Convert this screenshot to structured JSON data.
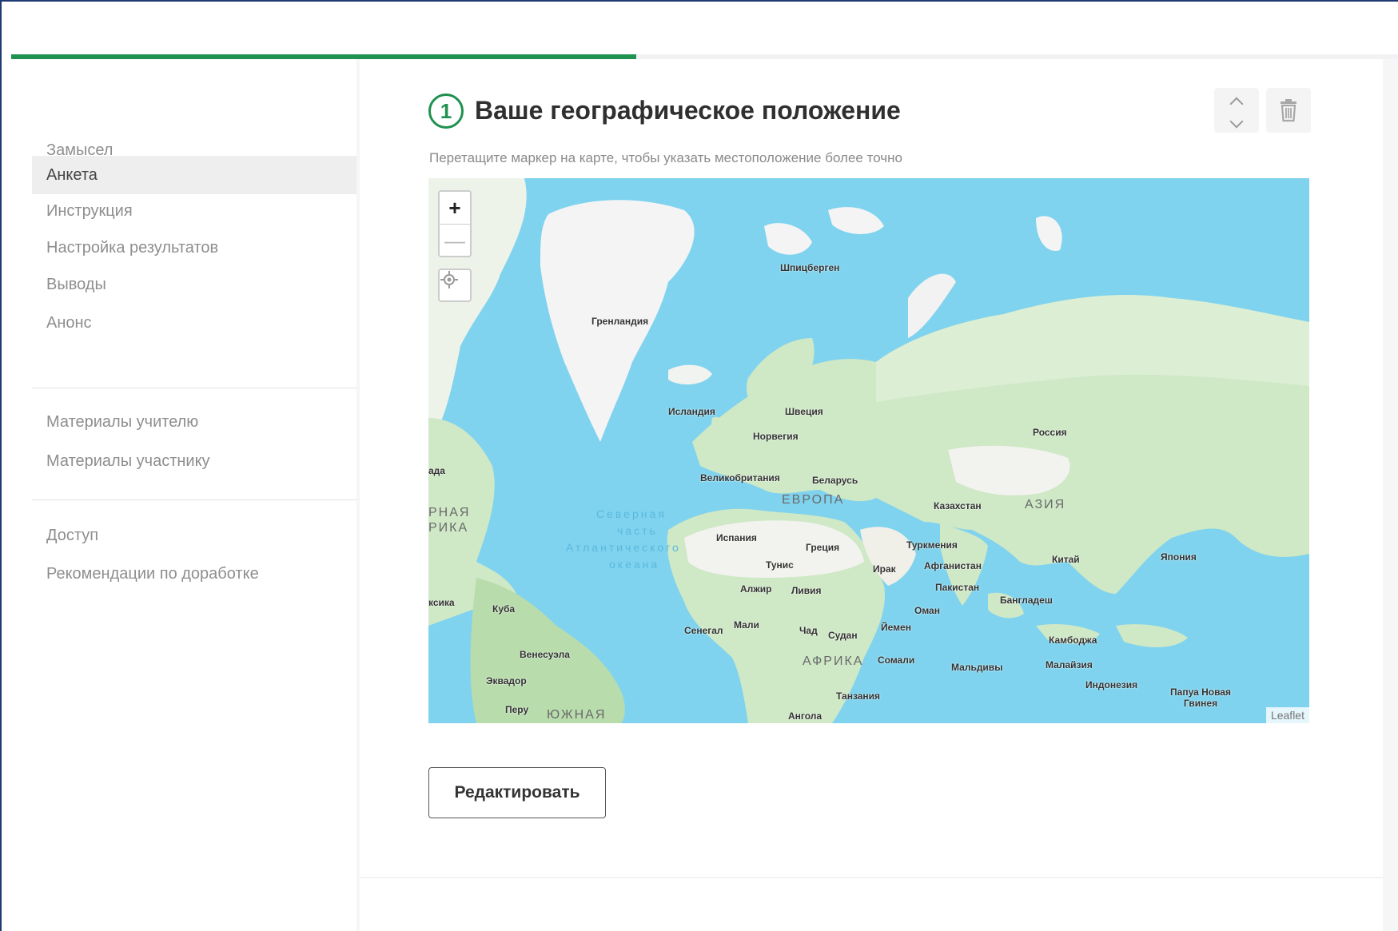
{
  "progress": {
    "fraction": 0.45
  },
  "sidebar": {
    "items": [
      {
        "label": "Замысел",
        "active": false
      },
      {
        "label": "Анкета",
        "active": true
      },
      {
        "label": "Инструкция",
        "active": false
      },
      {
        "label": "Настройка результатов",
        "active": false
      },
      {
        "label": "Выводы",
        "active": false
      },
      {
        "label": "Анонс",
        "active": false
      }
    ],
    "materials": [
      {
        "label": "Материалы учителю"
      },
      {
        "label": "Материалы участнику"
      }
    ],
    "other": [
      {
        "label": "Доступ"
      },
      {
        "label": "Рекомендации по доработке"
      }
    ]
  },
  "question": {
    "number": "1",
    "title": "Ваше географическое положение",
    "hint": "Перетащите маркер на карте, чтобы указать местоположение более точно",
    "controls": {
      "move": "chevron-updown-icon",
      "delete": "trash-icon"
    }
  },
  "map": {
    "zoom_in": "+",
    "zoom_out": "—",
    "attribution": "Leaflet",
    "colors": {
      "ocean": "#7fd3ee",
      "land": "#cfe8c6",
      "ice": "#f4f4f4"
    },
    "labels": {
      "svalbard": "Шпицберген",
      "greenland": "Гренландия",
      "iceland": "Исландия",
      "sweden": "Швеция",
      "norway": "Норвегия",
      "russia": "Россия",
      "uk": "Великобритания",
      "belarus": "Беларусь",
      "kazakhstan": "Казахстан",
      "turkmenistan": "Туркмения",
      "spain": "Испания",
      "greece": "Греция",
      "afghanistan": "Афганистан",
      "china": "Китай",
      "japan": "Япония",
      "tunisia": "Тунис",
      "iraq": "Ирак",
      "pakistan": "Пакистан",
      "algeria": "Алжир",
      "libya": "Ливия",
      "bangladesh": "Бангладеш",
      "oman": "Оман",
      "cuba": "Куба",
      "mexico_part": "ксика",
      "senegal": "Сенегал",
      "mali": "Мали",
      "chad": "Чад",
      "sudan": "Судан",
      "yemen": "Йемен",
      "cambodia": "Камбоджа",
      "venezuela": "Венесуэла",
      "somalia": "Сомали",
      "maldives": "Мальдивы",
      "malaysia": "Малайзия",
      "indonesia": "Индонезия",
      "ecuador": "Эквадор",
      "tanzania": "Танзания",
      "png": "Папуа Новая Гвинея",
      "peru": "Перу",
      "angola": "Ангола",
      "canada_part": "ада"
    },
    "regions": {
      "europe": "ЕВРОПА",
      "asia": "АЗИЯ",
      "africa": "АФРИКА",
      "south": "ЮЖНАЯ",
      "na1": "РНАЯ",
      "na2": "РИКА"
    },
    "oceans": {
      "line1": "Северная",
      "line2": "часть",
      "line3": "Атлантического",
      "line4": "океана"
    }
  },
  "actions": {
    "edit_label": "Редактировать"
  }
}
